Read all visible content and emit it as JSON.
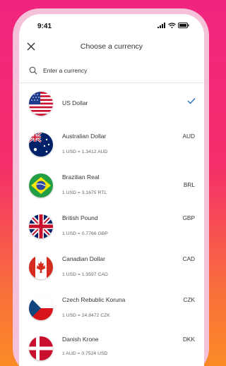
{
  "status_bar": {
    "time": "9:41"
  },
  "header": {
    "title": "Choose a currency"
  },
  "search": {
    "placeholder": "Enter a currency"
  },
  "currencies": [
    {
      "name": "US Dollar",
      "code": "",
      "rate": "",
      "selected": true,
      "flag": "us-flag-icon"
    },
    {
      "name": "Australian Dollar",
      "code": "AUD",
      "rate": "1 USD = 1.3412 AUD",
      "selected": false,
      "flag": "au-flag-icon"
    },
    {
      "name": "Brazilian Real",
      "code": "BRL",
      "rate": "1 USD = 3.1675 RTL",
      "selected": false,
      "flag": "br-flag-icon"
    },
    {
      "name": "British Pound",
      "code": "GBP",
      "rate": "1 USD = 0.7766 GBP",
      "selected": false,
      "flag": "gb-flag-icon"
    },
    {
      "name": "Canadian Dollar",
      "code": "CAD",
      "rate": "1 USD = 1.3597 CAD",
      "selected": false,
      "flag": "ca-flag-icon"
    },
    {
      "name": "Czech Rebublic Koruna",
      "code": "CZK",
      "rate": "1 USD = 24.8472 CZK",
      "selected": false,
      "flag": "cz-flag-icon"
    },
    {
      "name": "Danish Krone",
      "code": "DKK",
      "rate": "1 AUD = 0.7524 USD",
      "selected": false,
      "flag": "dk-flag-icon"
    }
  ],
  "colors": {
    "accent": "#2a6fc9",
    "gradient_top": "#f0247f",
    "gradient_bottom": "#fb8a26"
  }
}
